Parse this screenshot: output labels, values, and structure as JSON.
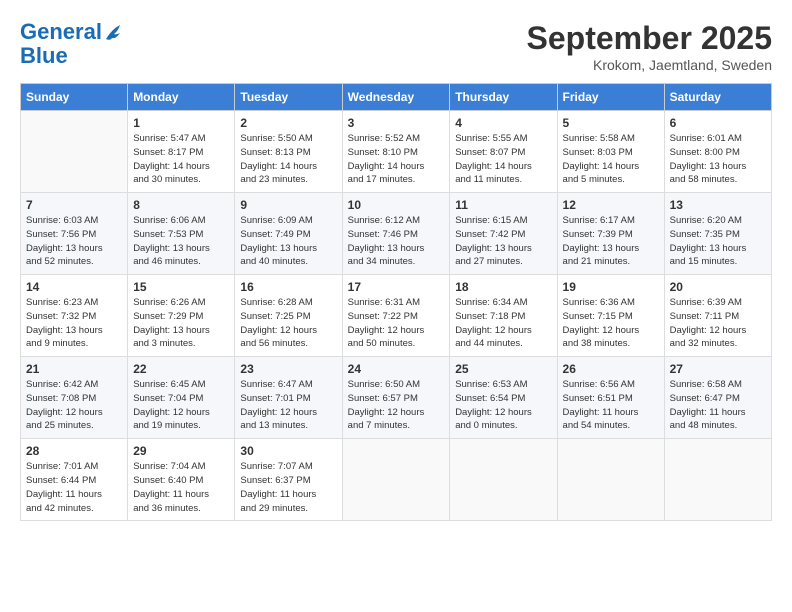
{
  "logo": {
    "line1": "General",
    "line2": "Blue"
  },
  "title": "September 2025",
  "location": "Krokom, Jaemtland, Sweden",
  "weekdays": [
    "Sunday",
    "Monday",
    "Tuesday",
    "Wednesday",
    "Thursday",
    "Friday",
    "Saturday"
  ],
  "weeks": [
    [
      {
        "day": "",
        "info": ""
      },
      {
        "day": "1",
        "info": "Sunrise: 5:47 AM\nSunset: 8:17 PM\nDaylight: 14 hours\nand 30 minutes."
      },
      {
        "day": "2",
        "info": "Sunrise: 5:50 AM\nSunset: 8:13 PM\nDaylight: 14 hours\nand 23 minutes."
      },
      {
        "day": "3",
        "info": "Sunrise: 5:52 AM\nSunset: 8:10 PM\nDaylight: 14 hours\nand 17 minutes."
      },
      {
        "day": "4",
        "info": "Sunrise: 5:55 AM\nSunset: 8:07 PM\nDaylight: 14 hours\nand 11 minutes."
      },
      {
        "day": "5",
        "info": "Sunrise: 5:58 AM\nSunset: 8:03 PM\nDaylight: 14 hours\nand 5 minutes."
      },
      {
        "day": "6",
        "info": "Sunrise: 6:01 AM\nSunset: 8:00 PM\nDaylight: 13 hours\nand 58 minutes."
      }
    ],
    [
      {
        "day": "7",
        "info": "Sunrise: 6:03 AM\nSunset: 7:56 PM\nDaylight: 13 hours\nand 52 minutes."
      },
      {
        "day": "8",
        "info": "Sunrise: 6:06 AM\nSunset: 7:53 PM\nDaylight: 13 hours\nand 46 minutes."
      },
      {
        "day": "9",
        "info": "Sunrise: 6:09 AM\nSunset: 7:49 PM\nDaylight: 13 hours\nand 40 minutes."
      },
      {
        "day": "10",
        "info": "Sunrise: 6:12 AM\nSunset: 7:46 PM\nDaylight: 13 hours\nand 34 minutes."
      },
      {
        "day": "11",
        "info": "Sunrise: 6:15 AM\nSunset: 7:42 PM\nDaylight: 13 hours\nand 27 minutes."
      },
      {
        "day": "12",
        "info": "Sunrise: 6:17 AM\nSunset: 7:39 PM\nDaylight: 13 hours\nand 21 minutes."
      },
      {
        "day": "13",
        "info": "Sunrise: 6:20 AM\nSunset: 7:35 PM\nDaylight: 13 hours\nand 15 minutes."
      }
    ],
    [
      {
        "day": "14",
        "info": "Sunrise: 6:23 AM\nSunset: 7:32 PM\nDaylight: 13 hours\nand 9 minutes."
      },
      {
        "day": "15",
        "info": "Sunrise: 6:26 AM\nSunset: 7:29 PM\nDaylight: 13 hours\nand 3 minutes."
      },
      {
        "day": "16",
        "info": "Sunrise: 6:28 AM\nSunset: 7:25 PM\nDaylight: 12 hours\nand 56 minutes."
      },
      {
        "day": "17",
        "info": "Sunrise: 6:31 AM\nSunset: 7:22 PM\nDaylight: 12 hours\nand 50 minutes."
      },
      {
        "day": "18",
        "info": "Sunrise: 6:34 AM\nSunset: 7:18 PM\nDaylight: 12 hours\nand 44 minutes."
      },
      {
        "day": "19",
        "info": "Sunrise: 6:36 AM\nSunset: 7:15 PM\nDaylight: 12 hours\nand 38 minutes."
      },
      {
        "day": "20",
        "info": "Sunrise: 6:39 AM\nSunset: 7:11 PM\nDaylight: 12 hours\nand 32 minutes."
      }
    ],
    [
      {
        "day": "21",
        "info": "Sunrise: 6:42 AM\nSunset: 7:08 PM\nDaylight: 12 hours\nand 25 minutes."
      },
      {
        "day": "22",
        "info": "Sunrise: 6:45 AM\nSunset: 7:04 PM\nDaylight: 12 hours\nand 19 minutes."
      },
      {
        "day": "23",
        "info": "Sunrise: 6:47 AM\nSunset: 7:01 PM\nDaylight: 12 hours\nand 13 minutes."
      },
      {
        "day": "24",
        "info": "Sunrise: 6:50 AM\nSunset: 6:57 PM\nDaylight: 12 hours\nand 7 minutes."
      },
      {
        "day": "25",
        "info": "Sunrise: 6:53 AM\nSunset: 6:54 PM\nDaylight: 12 hours\nand 0 minutes."
      },
      {
        "day": "26",
        "info": "Sunrise: 6:56 AM\nSunset: 6:51 PM\nDaylight: 11 hours\nand 54 minutes."
      },
      {
        "day": "27",
        "info": "Sunrise: 6:58 AM\nSunset: 6:47 PM\nDaylight: 11 hours\nand 48 minutes."
      }
    ],
    [
      {
        "day": "28",
        "info": "Sunrise: 7:01 AM\nSunset: 6:44 PM\nDaylight: 11 hours\nand 42 minutes."
      },
      {
        "day": "29",
        "info": "Sunrise: 7:04 AM\nSunset: 6:40 PM\nDaylight: 11 hours\nand 36 minutes."
      },
      {
        "day": "30",
        "info": "Sunrise: 7:07 AM\nSunset: 6:37 PM\nDaylight: 11 hours\nand 29 minutes."
      },
      {
        "day": "",
        "info": ""
      },
      {
        "day": "",
        "info": ""
      },
      {
        "day": "",
        "info": ""
      },
      {
        "day": "",
        "info": ""
      }
    ]
  ]
}
